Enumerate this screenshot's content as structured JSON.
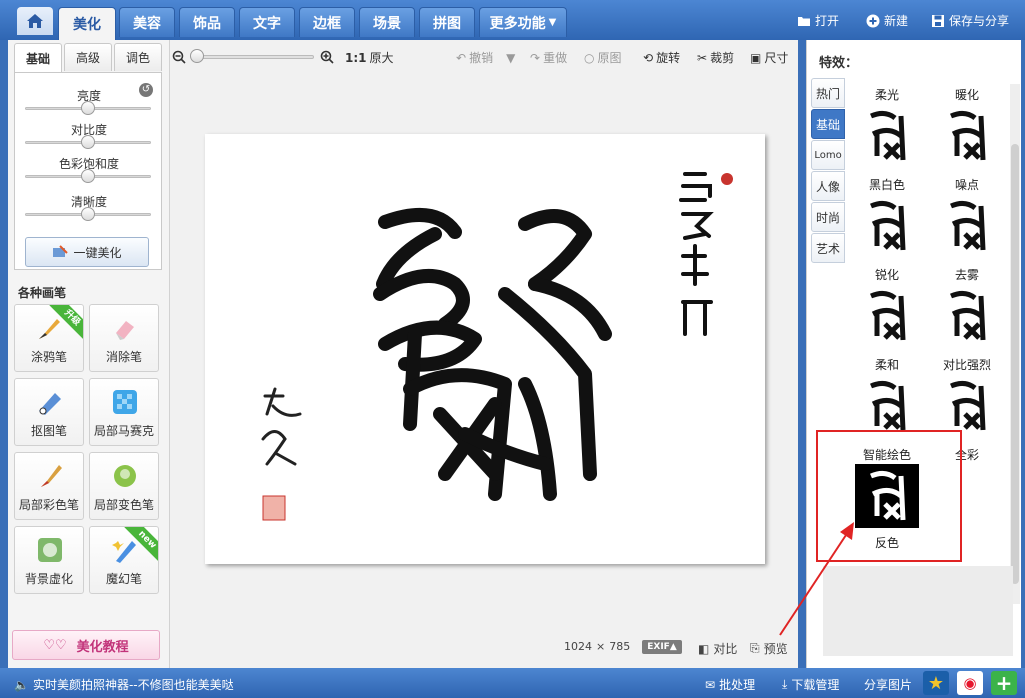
{
  "topnav": {
    "tabs": [
      "美化",
      "美容",
      "饰品",
      "文字",
      "边框",
      "场景",
      "拼图",
      "更多功能"
    ],
    "active_tab": "美化",
    "actions": [
      "打开",
      "新建",
      "保存与分享"
    ]
  },
  "left": {
    "subtabs": [
      "基础",
      "高级",
      "调色"
    ],
    "sliders": [
      {
        "label": "亮度",
        "value": 0.5
      },
      {
        "label": "对比度",
        "value": 0.5
      },
      {
        "label": "色彩饱和度",
        "value": 0.5
      },
      {
        "label": "清晰度",
        "value": 0.5
      }
    ],
    "one_click": "一键美化",
    "brushes_title": "各种画笔",
    "tools": [
      {
        "label": "涂鸦笔",
        "badge": "升级"
      },
      {
        "label": "消除笔",
        "badge": ""
      },
      {
        "label": "抠图笔",
        "badge": ""
      },
      {
        "label": "局部马赛克",
        "badge": ""
      },
      {
        "label": "局部彩色笔",
        "badge": ""
      },
      {
        "label": "局部变色笔",
        "badge": ""
      },
      {
        "label": "背景虚化",
        "badge": ""
      },
      {
        "label": "魔幻笔",
        "badge": "new"
      }
    ],
    "tutorial": "美化教程"
  },
  "toolbar": {
    "zoom_value": 0.0,
    "actual_size": "1:1",
    "actual_size_label": "原大",
    "undo": "撤销",
    "redo": "重做",
    "original": "原图",
    "rotate": "旋转",
    "crop": "裁剪",
    "resize": "尺寸"
  },
  "canvas": {
    "artwork_text": "鱼躍龍門",
    "signature": "文鑫"
  },
  "status": {
    "width": "1024",
    "times": "×",
    "height": "785",
    "exif": "EXIF▲",
    "compare": "对比",
    "preview": "预览"
  },
  "right": {
    "title": "特效：",
    "tabs": [
      "热门",
      "基础",
      "Lomo",
      "人像",
      "时尚",
      "艺术"
    ],
    "active_tab": "基础",
    "effects": [
      "柔光",
      "暖化",
      "黑白色",
      "噪点",
      "锐化",
      "去雾",
      "柔和",
      "对比强烈",
      "智能绘色",
      "全彩",
      "反色"
    ]
  },
  "bottom": {
    "promo": "实时美颜拍照神器--不修图也能美美哒",
    "batch": "批处理",
    "download": "下载管理",
    "share": "分享图片"
  },
  "colors": {
    "brand_blue": "#3f78c6",
    "highlight_red": "#e02424",
    "ribbon_green": "#49b53a"
  }
}
